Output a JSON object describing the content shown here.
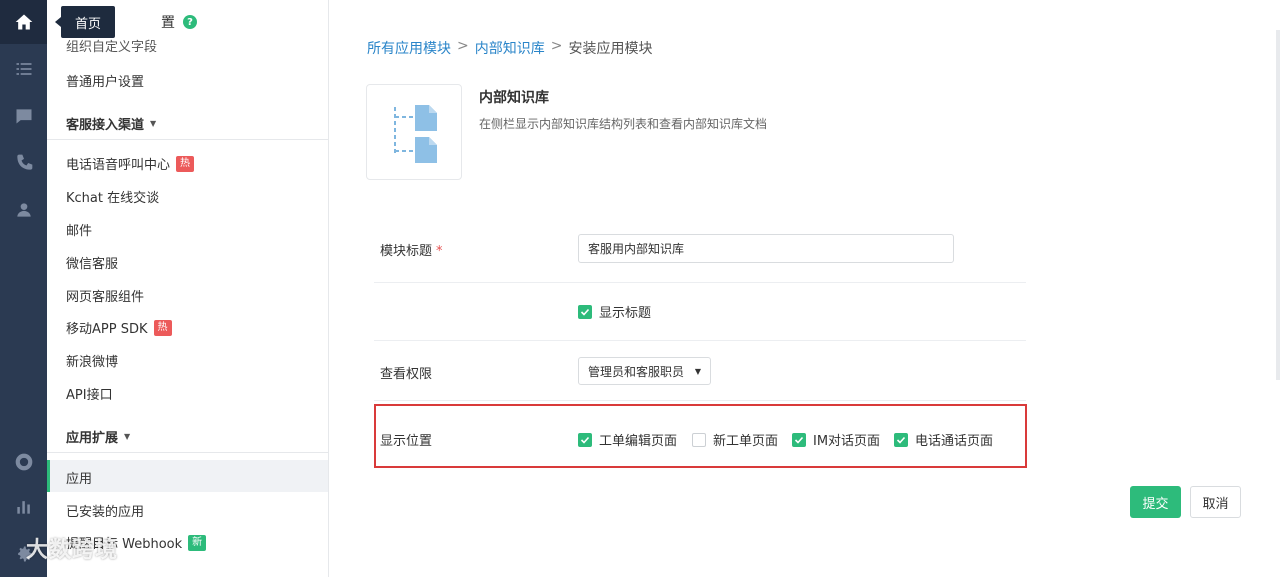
{
  "rail": {
    "items": [
      {
        "icon": "home-icon",
        "active": true
      },
      {
        "icon": "list-icon",
        "active": false
      },
      {
        "icon": "chat-icon",
        "active": false
      },
      {
        "icon": "phone-icon",
        "active": false
      },
      {
        "icon": "user-icon",
        "active": false
      },
      {
        "icon": "support-icon",
        "active": false
      },
      {
        "icon": "bar-chart-icon",
        "active": false
      },
      {
        "icon": "gear-icon",
        "active": false
      }
    ],
    "tooltip": "首页"
  },
  "sidebar": {
    "heading": "置",
    "help": "?",
    "cut_item": "组织自定义字段",
    "items_top": [
      "普通用户设置"
    ],
    "group_channels": "客服接入渠道",
    "channels": [
      {
        "label": "电话语音呼叫中心",
        "badge": "热"
      },
      {
        "label": "Kchat 在线交谈"
      },
      {
        "label": "邮件"
      },
      {
        "label": "微信客服"
      },
      {
        "label": "网页客服组件"
      },
      {
        "label": "移动APP SDK",
        "badge": "热"
      },
      {
        "label": "新浪微博"
      },
      {
        "label": "API接口"
      }
    ],
    "group_ext": "应用扩展",
    "ext": [
      {
        "label": "应用",
        "active": true
      },
      {
        "label": "已安装的应用"
      },
      {
        "label": "提醒目标 Webhook",
        "badge": "新"
      }
    ]
  },
  "watermark": "大数跨境",
  "breadcrumb": {
    "all": "所有应用模块",
    "sep1": ">",
    "kb": "内部知识库",
    "sep2": ">",
    "current": "安装应用模块"
  },
  "module": {
    "title": "内部知识库",
    "desc": "在侧栏显示内部知识库结构列表和查看内部知识库文档"
  },
  "form": {
    "title_label": "模块标题",
    "required_mark": "*",
    "title_value": "客服用内部知识库",
    "show_title_label": "显示标题",
    "show_title_checked": true,
    "permission_label": "查看权限",
    "permission_value": "管理员和客服职员",
    "position_label": "显示位置",
    "positions": [
      {
        "label": "工单编辑页面",
        "checked": true
      },
      {
        "label": "新工单页面",
        "checked": false
      },
      {
        "label": "IM对话页面",
        "checked": true
      },
      {
        "label": "电话通话页面",
        "checked": true
      }
    ]
  },
  "buttons": {
    "submit": "提交",
    "cancel": "取消"
  },
  "colors": {
    "accent": "#2dbb7b",
    "link": "#2a85c9",
    "rail": "#2b3a52",
    "highlight": "#d93a3a",
    "hot_badge": "#ec5a5a"
  }
}
